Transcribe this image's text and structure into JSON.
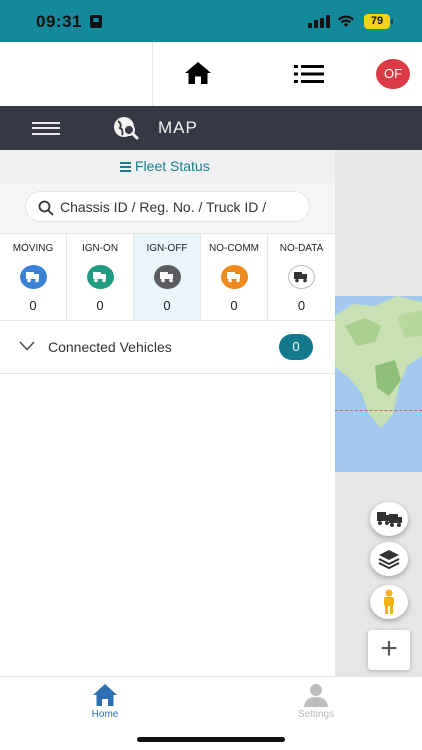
{
  "status_bar": {
    "time": "09:31",
    "battery": "79"
  },
  "top_nav": {
    "home_icon": "home-icon",
    "list_icon": "list-icon",
    "avatar_text": "OF",
    "avatar_color": "#dc3a44"
  },
  "header": {
    "title": "MAP",
    "menu_icon": "hamburger-icon",
    "map_icon": "map-search-icon",
    "bg_color": "#363945"
  },
  "fleet_status": {
    "label": "Fleet Status",
    "accent_color": "#1a7d8e"
  },
  "search": {
    "placeholder": "Chassis ID / Reg. No. / Truck ID /"
  },
  "status_tiles": [
    {
      "label": "MOVING",
      "count": "0",
      "color": "#3b82d6",
      "icon": "truck-icon"
    },
    {
      "label": "IGN-ON",
      "count": "0",
      "color": "#1e9b80",
      "icon": "truck-icon"
    },
    {
      "label": "IGN-OFF",
      "count": "0",
      "color": "#5a5c62",
      "icon": "truck-icon",
      "selected": true
    },
    {
      "label": "NO-COMM",
      "count": "0",
      "color": "#ec8a1d",
      "icon": "truck-icon"
    },
    {
      "label": "NO-DATA",
      "count": "0",
      "color": "#ffffff",
      "icon": "truck-icon"
    }
  ],
  "connected": {
    "label": "Connected Vehicles",
    "count": "0",
    "badge_color": "#127a8c"
  },
  "map_controls": {
    "buttons": [
      "trucks-icon",
      "layers-icon",
      "street-view-person-icon"
    ],
    "zoom_in": "+"
  },
  "tab_bar": {
    "home_label": "Home",
    "settings_label": "Settings",
    "active_color": "#2f6fb3"
  }
}
